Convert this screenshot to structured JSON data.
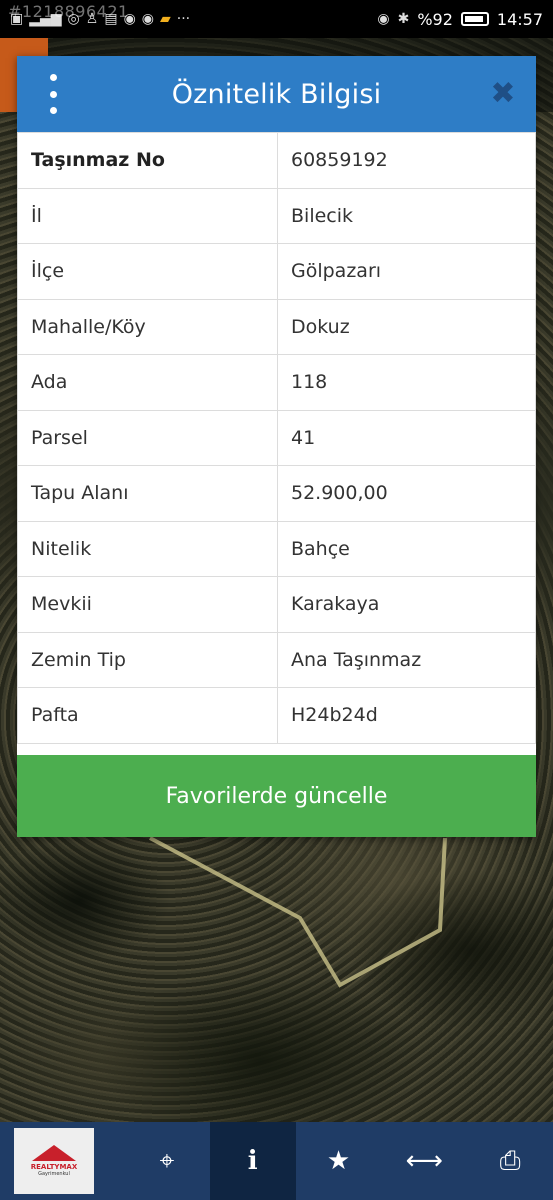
{
  "status_bar": {
    "watermark_id": "#1218896421",
    "battery": "%92",
    "time": "14:57",
    "left_icons": [
      "volte-icon",
      "signal-icon",
      "hotspot-icon",
      "walk-icon",
      "news-icon",
      "chrome-icon",
      "chrome-icon",
      "taxi-icon",
      "more-icon"
    ],
    "right_icons": [
      "eye-icon",
      "bluetooth-icon",
      "battery-icon"
    ]
  },
  "dialog": {
    "title": "Öznitelik Bilgisi",
    "rows": [
      {
        "key": "Taşınmaz No",
        "value": "60859192"
      },
      {
        "key": "İl",
        "value": "Bilecik"
      },
      {
        "key": "İlçe",
        "value": "Gölpazarı"
      },
      {
        "key": "Mahalle/Köy",
        "value": "Dokuz"
      },
      {
        "key": "Ada",
        "value": "118"
      },
      {
        "key": "Parsel",
        "value": "41"
      },
      {
        "key": "Tapu Alanı",
        "value": "52.900,00"
      },
      {
        "key": "Nitelik",
        "value": "Bahçe"
      },
      {
        "key": "Mevkii",
        "value": "Karakaya"
      },
      {
        "key": "Zemin Tip",
        "value": "Ana Taşınmaz"
      },
      {
        "key": "Pafta",
        "value": "H24b24d"
      }
    ],
    "update_button": "Favorilerde güncelle"
  },
  "bottom_bar": {
    "logo_text": "REALTYMAX",
    "logo_sub": "Gayrimenkul",
    "items": [
      "locate-icon",
      "info-icon",
      "star-icon",
      "measure-icon",
      "print-icon"
    ],
    "active": "info-icon"
  },
  "colors": {
    "header": "#2e7dc6",
    "button": "#4cae4f",
    "bottom_bar": "#1f3c66",
    "close": "#1f4f86"
  }
}
